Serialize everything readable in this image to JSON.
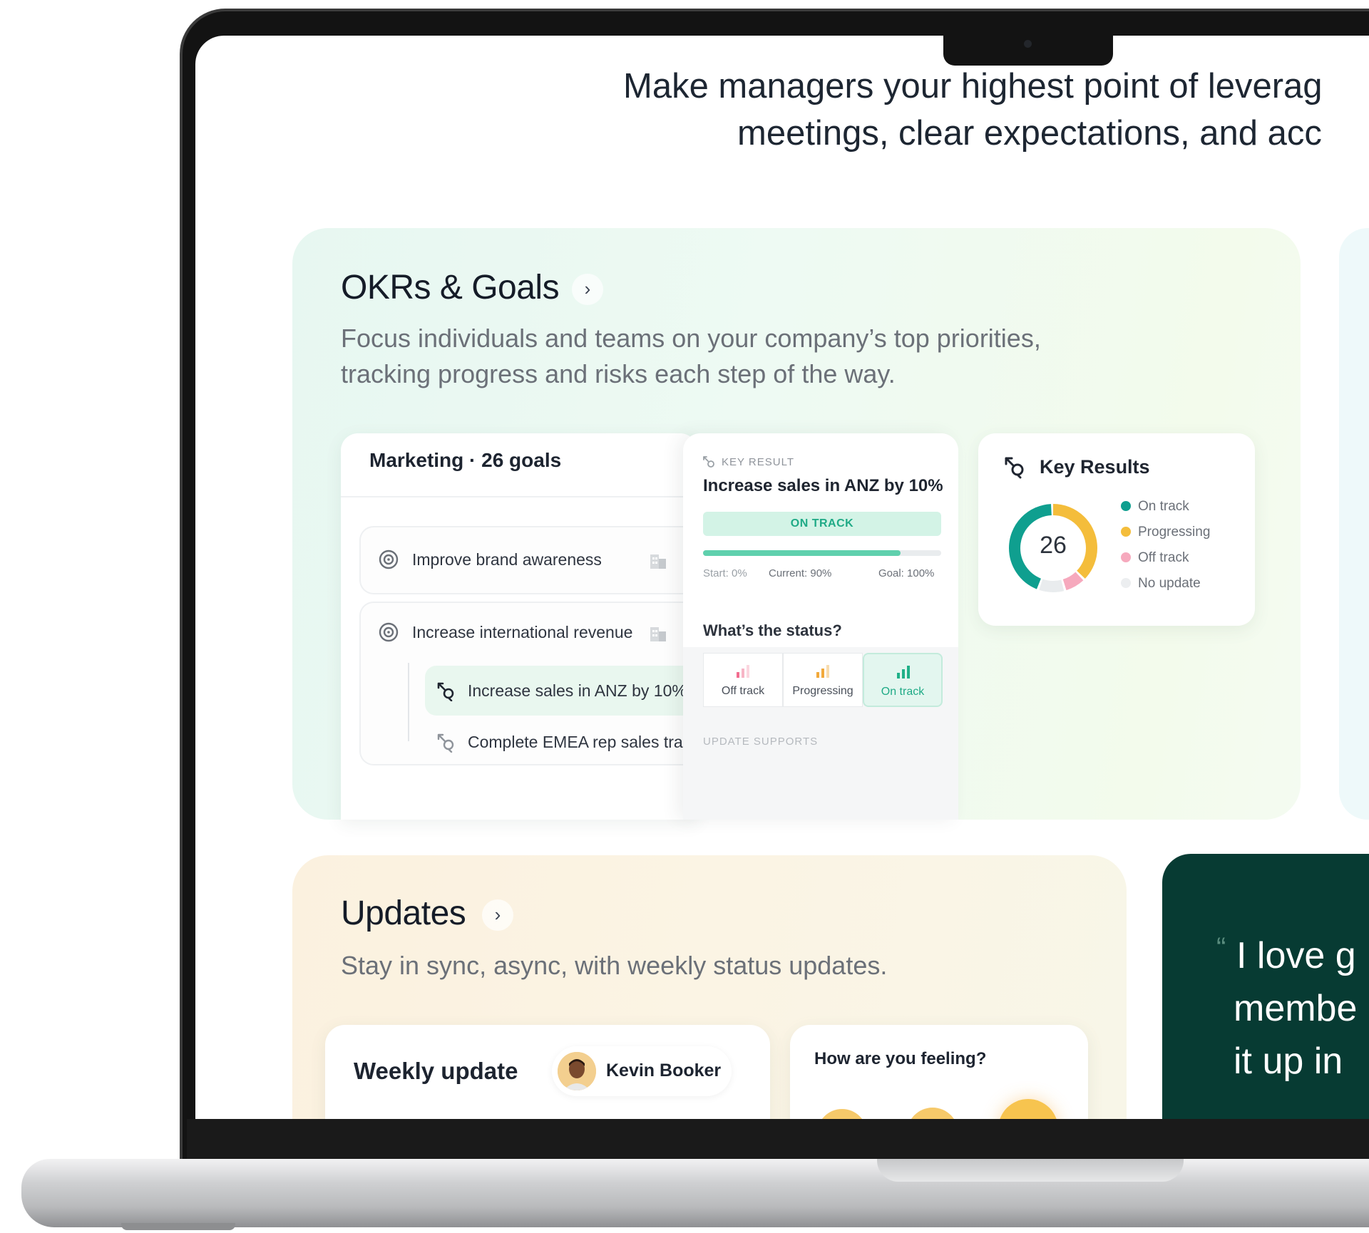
{
  "hero": {
    "line1": "Make managers your highest point of leverag",
    "line2": "meetings, clear expectations, and acc"
  },
  "okrs": {
    "title": "OKRs & Goals",
    "chevron": "›",
    "desc_line1": "Focus individuals and teams on your company’s top priorities,",
    "desc_line2": "tracking progress and risks each step of the way.",
    "goals_panel": {
      "header": "Marketing · 26 goals",
      "goals": [
        {
          "label": "Improve brand awareness",
          "icon": "target-icon"
        },
        {
          "label": "Increase international revenue",
          "icon": "target-icon"
        }
      ],
      "key_results": [
        {
          "label": "Increase sales in ANZ by 10%",
          "icon": "key-result-icon",
          "highlighted": true
        },
        {
          "label": "Complete EMEA rep sales trainin",
          "icon": "key-result-icon",
          "highlighted": false
        }
      ]
    },
    "key_result_detail": {
      "tag": "KEY RESULT",
      "title": "Increase sales in ANZ by 10%",
      "status_badge": "ON TRACK",
      "progress_fraction": 0.83,
      "start": "Start: 0%",
      "current": "Current: 90%",
      "goal": "Goal: 100%",
      "question": "What’s the status?",
      "options": [
        {
          "label": "Off track",
          "color": "#f26d8f"
        },
        {
          "label": "Progressing",
          "color": "#f2a93b"
        },
        {
          "label": "On track",
          "color": "#20b088",
          "selected": true
        }
      ],
      "footer": "UPDATE SUPPORTS"
    },
    "key_results_summary": {
      "title": "Key Results",
      "total": "26",
      "legend": [
        {
          "label": "On track",
          "color": "#0f9f8f",
          "share": 0.44
        },
        {
          "label": "Progressing",
          "color": "#f4bd3b",
          "share": 0.38
        },
        {
          "label": "Off track",
          "color": "#f6a9bd",
          "share": 0.08
        },
        {
          "label": "No update",
          "color": "#e9ecee",
          "share": 0.1
        }
      ]
    }
  },
  "updates": {
    "title": "Updates",
    "chevron": "›",
    "desc": "Stay in sync, async, with weekly status updates.",
    "weekly_card": {
      "title": "Weekly update",
      "person": "Kevin Booker"
    },
    "feeling_card": {
      "title": "How are you feeling?"
    }
  },
  "testimonial": {
    "quote_mark": "“",
    "line1": "I love g",
    "line2": "membe",
    "line3": "it up in"
  },
  "colors": {
    "accent_green": "#1faa86",
    "quote_bg": "#073b33"
  }
}
